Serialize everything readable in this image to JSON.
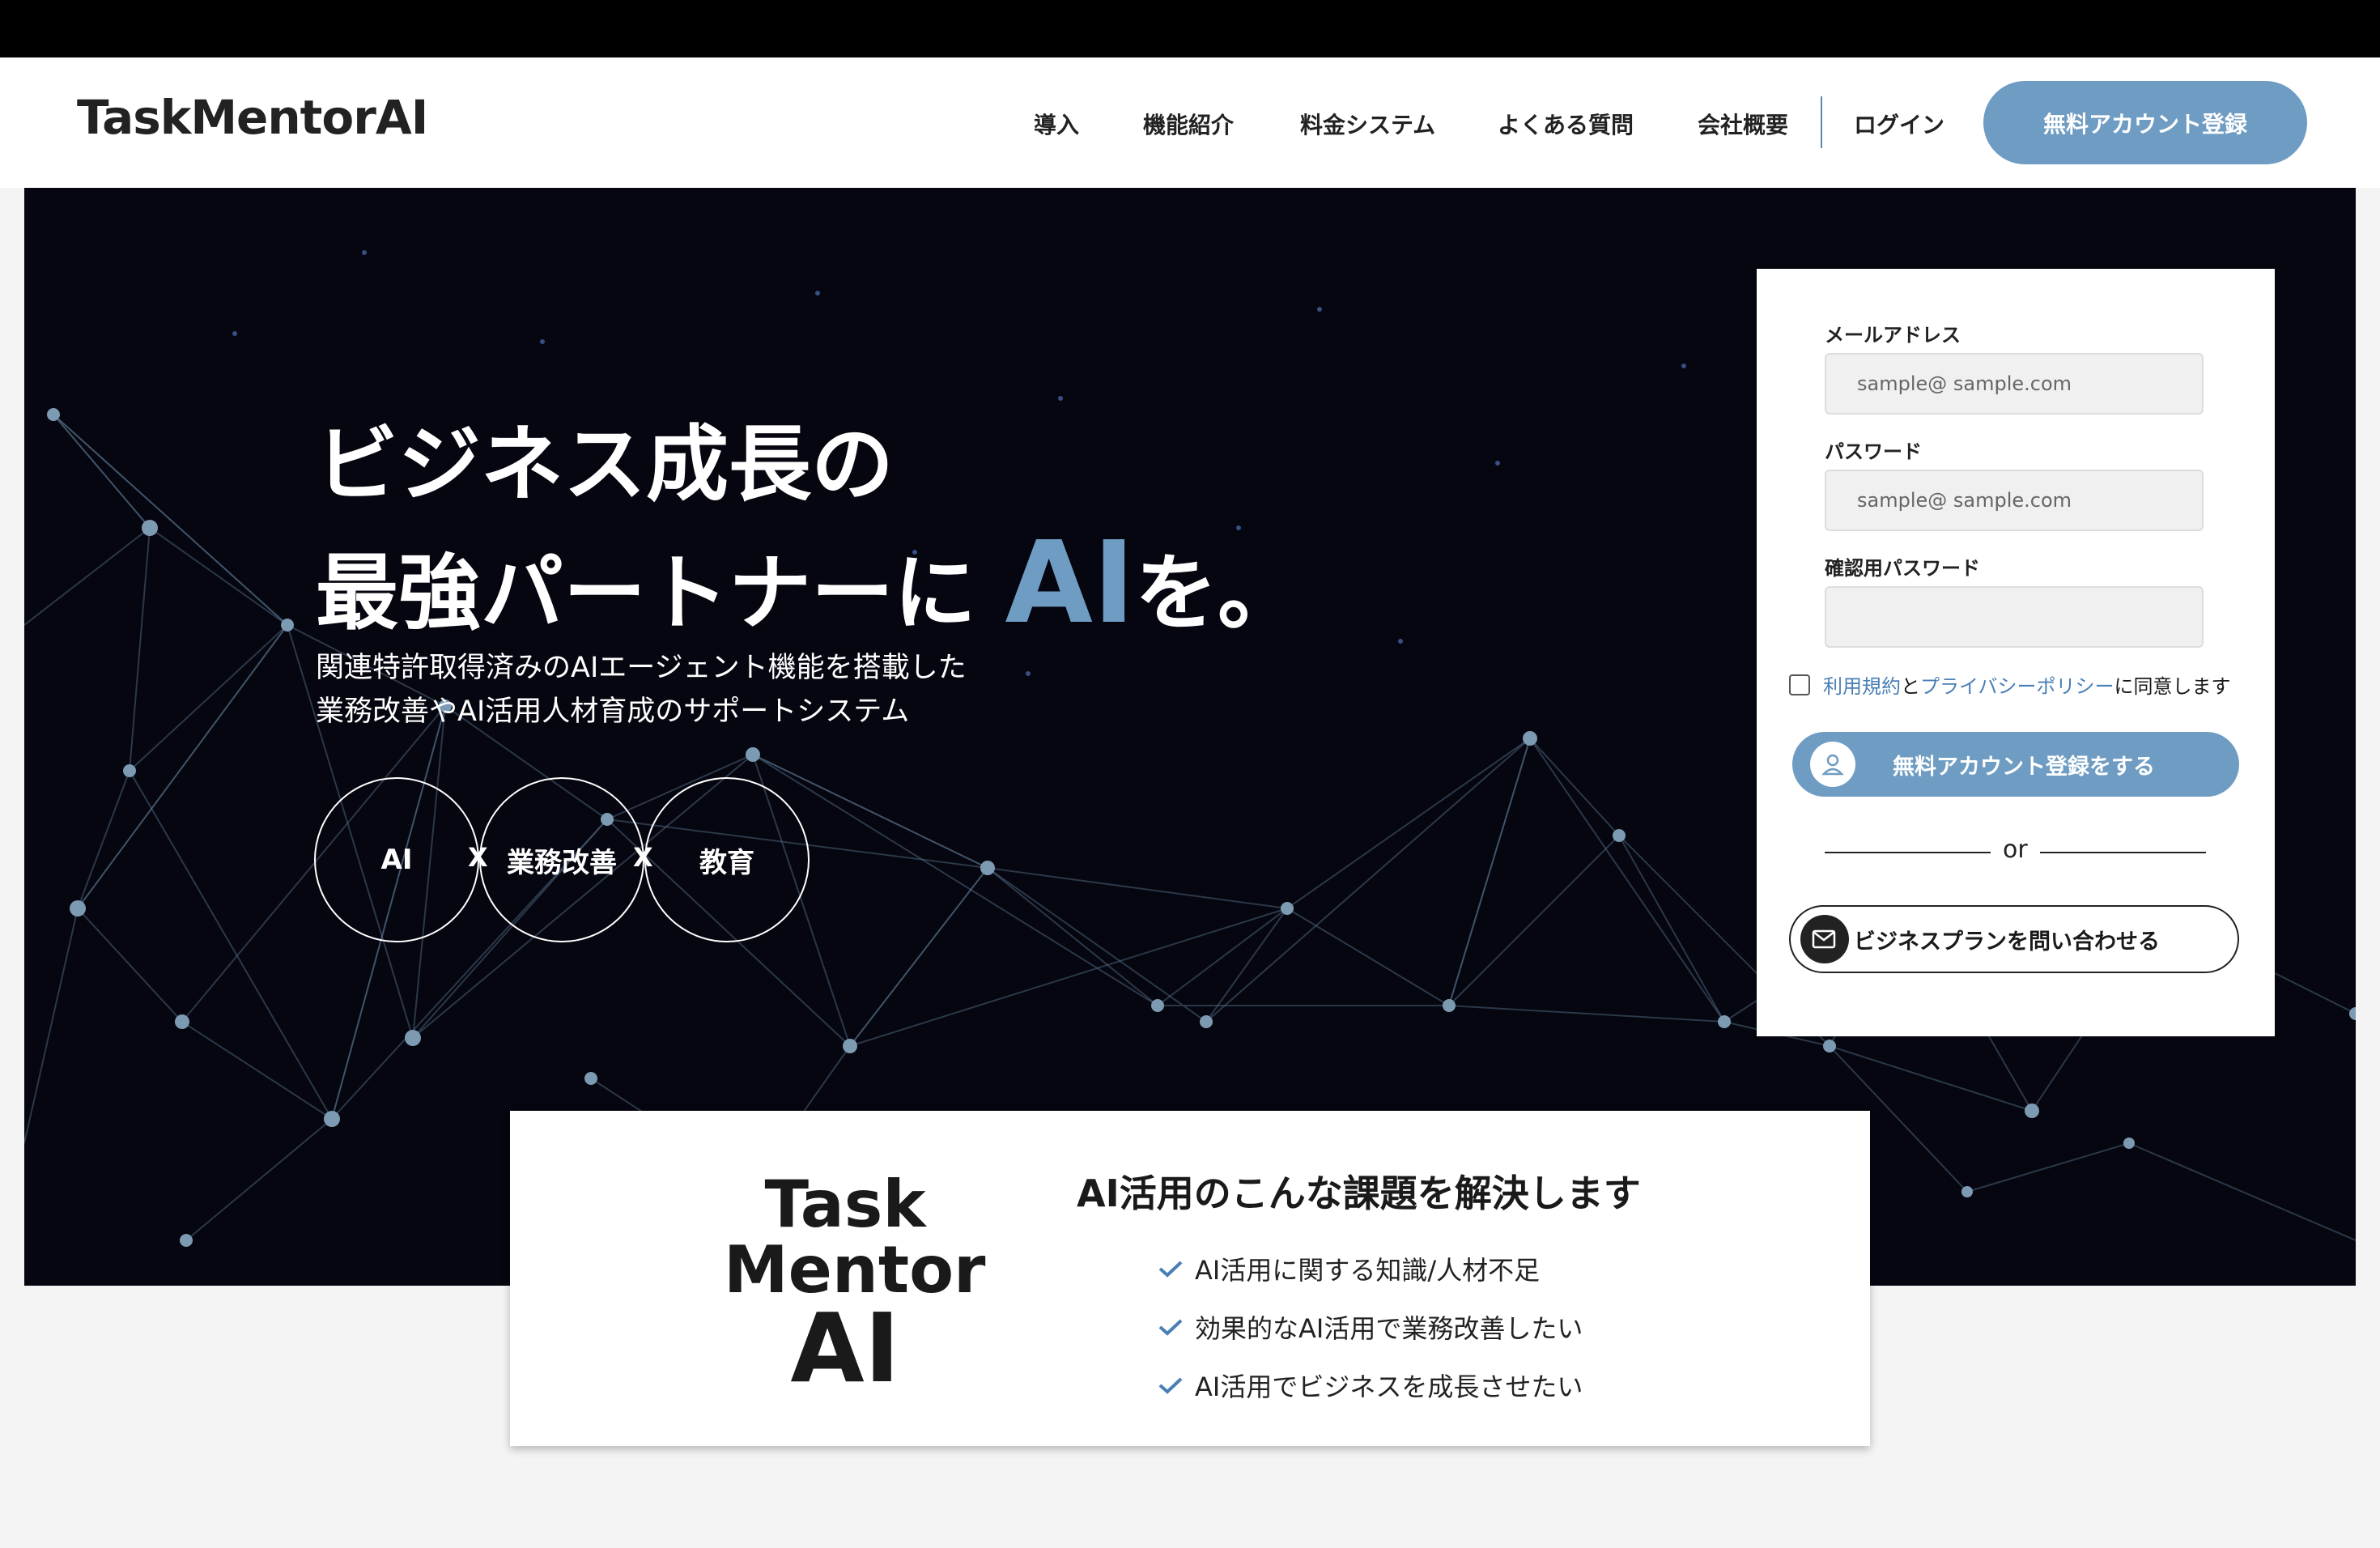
{
  "header": {
    "logo": "TaskMentorAI",
    "nav": [
      "導入",
      "機能紹介",
      "料金システム",
      "よくある質問",
      "会社概要"
    ],
    "login": "ログイン",
    "cta": "無料アカウント登録"
  },
  "hero": {
    "title_line1": "ビジネス成長の",
    "title_line2_prefix": "最強パートナーに",
    "title_line2_ai": "AI",
    "title_line2_suffix": "を。",
    "subtitle_line1": "関連特許取得済みのAIエージェント機能を搭載した",
    "subtitle_line2": "業務改善やAI活用人材育成のサポートシステム",
    "circles": [
      "AI",
      "業務改善",
      "教育"
    ],
    "cross": "X"
  },
  "form": {
    "email_label": "メールアドレス",
    "email_placeholder": "sample@ sample.com",
    "password_label": "パスワード",
    "password_placeholder": "sample@ sample.com",
    "confirm_label": "確認用パスワード",
    "confirm_placeholder": "",
    "agree_terms": "利用規約",
    "agree_and": "と",
    "agree_privacy": "プライバシーポリシー",
    "agree_suffix": "に同意します",
    "register_button": "無料アカウント登録をする",
    "or": "or",
    "contact_button": "ビジネスプランを問い合わせる"
  },
  "card": {
    "logo_line1": "Task",
    "logo_line2": "Mentor",
    "logo_line3": "AI",
    "title": "AI活用のこんな課題を解決します",
    "items": [
      "AI活用に関する知識/人材不足",
      "効果的なAI活用で業務改善したい",
      "AI活用でビジネスを成長させたい"
    ]
  },
  "colors": {
    "accent": "#6f9cc3",
    "hero_bg": "#05060f",
    "link": "#4a7fb5"
  }
}
